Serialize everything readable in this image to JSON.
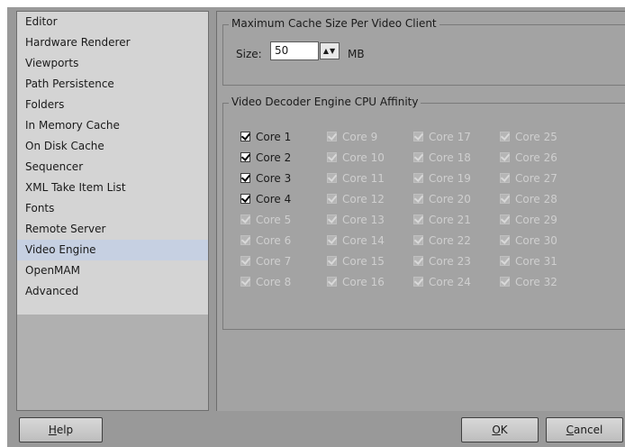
{
  "sidebar": {
    "items": [
      {
        "label": "Editor"
      },
      {
        "label": "Hardware Renderer"
      },
      {
        "label": "Viewports"
      },
      {
        "label": "Path Persistence"
      },
      {
        "label": "Folders"
      },
      {
        "label": "In Memory Cache"
      },
      {
        "label": "On Disk Cache"
      },
      {
        "label": "Sequencer"
      },
      {
        "label": "XML Take Item List"
      },
      {
        "label": "Fonts"
      },
      {
        "label": "Remote Server"
      },
      {
        "label": "Video Engine"
      },
      {
        "label": "OpenMAM"
      },
      {
        "label": "Advanced"
      }
    ],
    "selected": "Video Engine"
  },
  "cache_group": {
    "title": "Maximum Cache Size Per Video Client",
    "size_label": "Size:",
    "size_value": "50",
    "unit": "MB"
  },
  "affinity_group": {
    "title": "Video Decoder Engine CPU Affinity",
    "cores": [
      {
        "label": "Core 1",
        "checked": true,
        "enabled": true
      },
      {
        "label": "Core 2",
        "checked": true,
        "enabled": true
      },
      {
        "label": "Core 3",
        "checked": true,
        "enabled": true
      },
      {
        "label": "Core 4",
        "checked": true,
        "enabled": true
      },
      {
        "label": "Core 5",
        "checked": true,
        "enabled": false
      },
      {
        "label": "Core 6",
        "checked": true,
        "enabled": false
      },
      {
        "label": "Core 7",
        "checked": true,
        "enabled": false
      },
      {
        "label": "Core 8",
        "checked": true,
        "enabled": false
      },
      {
        "label": "Core 9",
        "checked": true,
        "enabled": false
      },
      {
        "label": "Core 10",
        "checked": true,
        "enabled": false
      },
      {
        "label": "Core 11",
        "checked": true,
        "enabled": false
      },
      {
        "label": "Core 12",
        "checked": true,
        "enabled": false
      },
      {
        "label": "Core 13",
        "checked": true,
        "enabled": false
      },
      {
        "label": "Core 14",
        "checked": true,
        "enabled": false
      },
      {
        "label": "Core 15",
        "checked": true,
        "enabled": false
      },
      {
        "label": "Core 16",
        "checked": true,
        "enabled": false
      },
      {
        "label": "Core 17",
        "checked": true,
        "enabled": false
      },
      {
        "label": "Core 18",
        "checked": true,
        "enabled": false
      },
      {
        "label": "Core 19",
        "checked": true,
        "enabled": false
      },
      {
        "label": "Core 20",
        "checked": true,
        "enabled": false
      },
      {
        "label": "Core 21",
        "checked": true,
        "enabled": false
      },
      {
        "label": "Core 22",
        "checked": true,
        "enabled": false
      },
      {
        "label": "Core 23",
        "checked": true,
        "enabled": false
      },
      {
        "label": "Core 24",
        "checked": true,
        "enabled": false
      },
      {
        "label": "Core 25",
        "checked": true,
        "enabled": false
      },
      {
        "label": "Core 26",
        "checked": true,
        "enabled": false
      },
      {
        "label": "Core 27",
        "checked": true,
        "enabled": false
      },
      {
        "label": "Core 28",
        "checked": true,
        "enabled": false
      },
      {
        "label": "Core 29",
        "checked": true,
        "enabled": false
      },
      {
        "label": "Core 30",
        "checked": true,
        "enabled": false
      },
      {
        "label": "Core 31",
        "checked": true,
        "enabled": false
      },
      {
        "label": "Core 32",
        "checked": true,
        "enabled": false
      }
    ]
  },
  "buttons": {
    "help": {
      "before": "",
      "mnemonic": "H",
      "after": "elp"
    },
    "ok": {
      "before": "",
      "mnemonic": "O",
      "after": "K"
    },
    "cancel": {
      "before": "",
      "mnemonic": "C",
      "after": "ancel"
    }
  },
  "colors": {
    "selection": "#c6d0e2",
    "panel": "#a3a3a3",
    "sidebar_bg": "#d4d4d4",
    "disabled_text": "#cfcfcf"
  }
}
